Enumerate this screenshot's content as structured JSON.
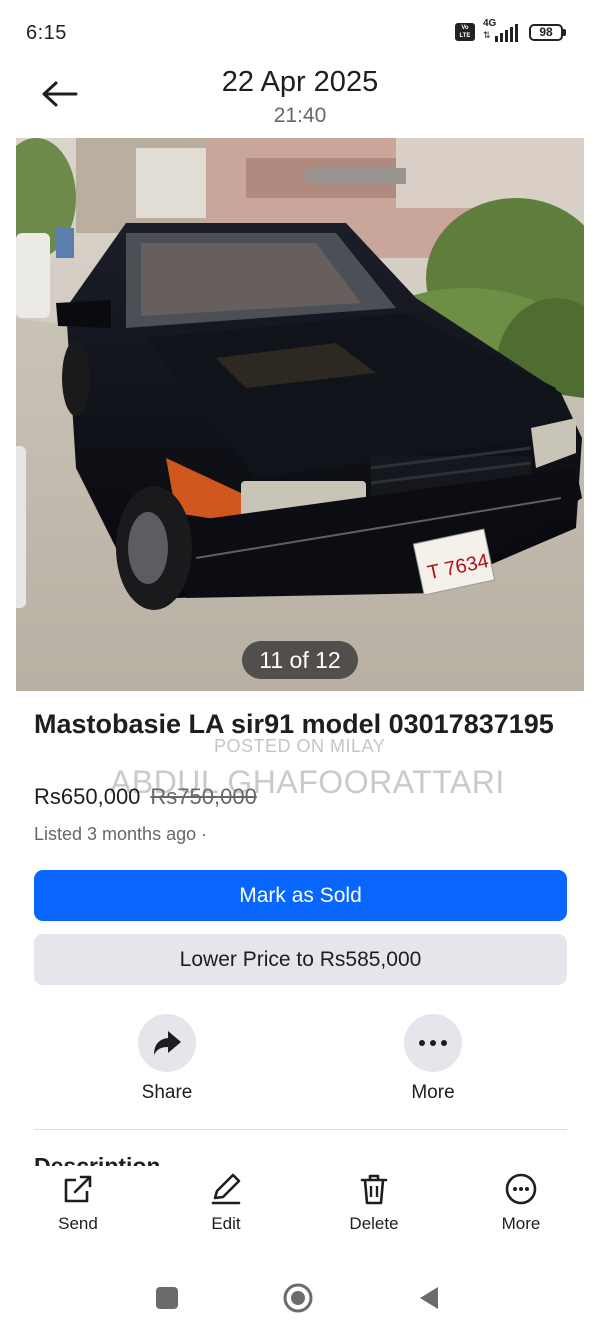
{
  "status_bar": {
    "time": "6:15",
    "volte_label": "Vo LTE",
    "network": "4G",
    "battery": "98"
  },
  "header": {
    "date": "22 Apr 2025",
    "time": "21:40"
  },
  "photo": {
    "counter": "11 of 12",
    "plate_text": "T 7634"
  },
  "listing": {
    "title": "Mastobasie LA sir91 model 03017837195",
    "price": "Rs650,000",
    "original_price": "Rs750,000",
    "listed": "Listed 3 months ago ·"
  },
  "watermark": {
    "line1": "POSTED ON MILAY",
    "line2": "ABDUL GHAFOORATTARI"
  },
  "buttons": {
    "mark_sold": "Mark as Sold",
    "lower_price": "Lower Price to Rs585,000"
  },
  "actions": {
    "share": "Share",
    "more": "More"
  },
  "section_peek": "Description",
  "toolbar": {
    "send": "Send",
    "edit": "Edit",
    "delete": "Delete",
    "more": "More"
  },
  "colors": {
    "primary": "#0866ff",
    "secondary_bg": "#e4e6eb",
    "muted_text": "#65676b"
  },
  "icons": [
    "back-arrow-icon",
    "share-arrow-icon",
    "more-dots-icon",
    "send-external-icon",
    "edit-pencil-icon",
    "delete-trash-icon",
    "more-circle-icon",
    "nav-recents-icon",
    "nav-home-icon",
    "nav-back-icon"
  ]
}
